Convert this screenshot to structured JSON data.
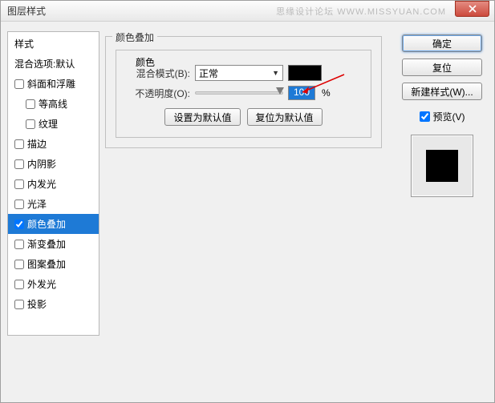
{
  "window": {
    "title": "图层样式",
    "watermark": "思缘设计论坛  WWW.MISSYUAN.COM"
  },
  "styles": {
    "header": "样式",
    "blending": "混合选项:默认",
    "items": [
      {
        "label": "斜面和浮雕",
        "checked": false,
        "indent": false
      },
      {
        "label": "等高线",
        "checked": false,
        "indent": true
      },
      {
        "label": "纹理",
        "checked": false,
        "indent": true
      },
      {
        "label": "描边",
        "checked": false,
        "indent": false
      },
      {
        "label": "内阴影",
        "checked": false,
        "indent": false
      },
      {
        "label": "内发光",
        "checked": false,
        "indent": false
      },
      {
        "label": "光泽",
        "checked": false,
        "indent": false
      },
      {
        "label": "颜色叠加",
        "checked": true,
        "indent": false,
        "selected": true
      },
      {
        "label": "渐变叠加",
        "checked": false,
        "indent": false
      },
      {
        "label": "图案叠加",
        "checked": false,
        "indent": false
      },
      {
        "label": "外发光",
        "checked": false,
        "indent": false
      },
      {
        "label": "投影",
        "checked": false,
        "indent": false
      }
    ]
  },
  "panel": {
    "title": "颜色叠加",
    "group": "颜色",
    "blend_label": "混合模式(B):",
    "blend_value": "正常",
    "opacity_label": "不透明度(O):",
    "opacity_value": "100",
    "opacity_unit": "%",
    "color_hex": "#000000",
    "btn_default": "设置为默认值",
    "btn_reset": "复位为默认值"
  },
  "right": {
    "ok": "确定",
    "cancel": "复位",
    "new_style": "新建样式(W)...",
    "preview_label": "预览(V)",
    "preview_checked": true
  }
}
